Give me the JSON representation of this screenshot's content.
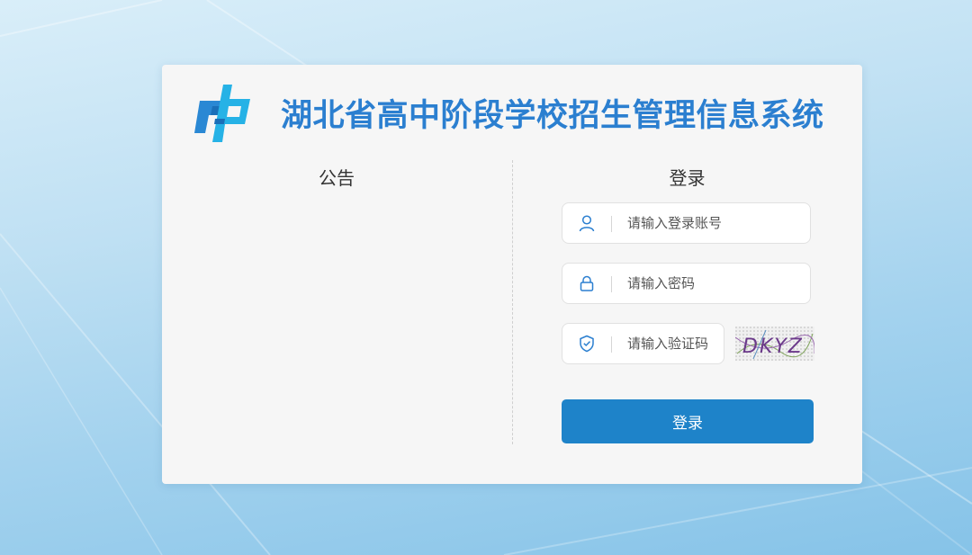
{
  "header": {
    "title": "湖北省高中阶段学校招生管理信息系统",
    "logo_icon": "cp-logo-icon"
  },
  "notice": {
    "title": "公告"
  },
  "login": {
    "title": "登录",
    "username": {
      "placeholder": "请输入登录账号",
      "value": "",
      "icon": "user-icon"
    },
    "password": {
      "placeholder": "请输入密码",
      "value": "",
      "icon": "lock-icon"
    },
    "captcha": {
      "placeholder": "请输入验证码",
      "value": "",
      "icon": "shield-check-icon",
      "image_text": "DKYZ"
    },
    "submit_label": "登录"
  },
  "colors": {
    "brand": "#2b7fd0",
    "button": "#1e83c9",
    "card": "#f6f6f6",
    "icon": "#2b7fd0"
  }
}
